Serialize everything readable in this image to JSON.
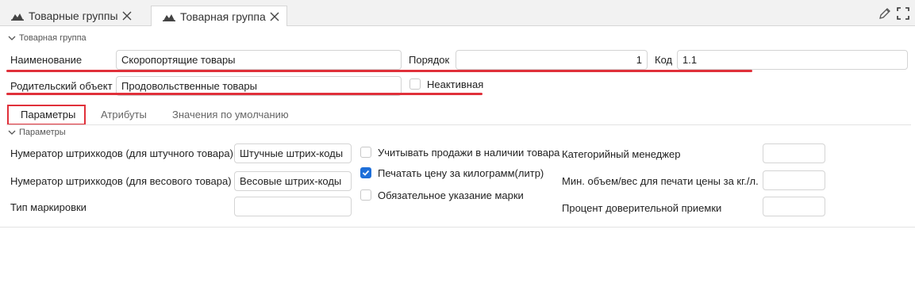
{
  "tabs": [
    {
      "label": "Товарные группы",
      "active": false
    },
    {
      "label": "Товарная группа",
      "active": true
    }
  ],
  "toolbar_icons": [
    "pencil-icon",
    "expand-icon"
  ],
  "group_section": {
    "title": "Товарная группа",
    "name_label": "Наименование",
    "name_value": "Скоропортящие товары",
    "order_label": "Порядок",
    "order_value": "1",
    "code_label": "Код",
    "code_value": "1.1",
    "parent_label": "Родительский объект",
    "parent_value": "Продовольственные товары",
    "inactive_label": "Неактивная",
    "inactive_checked": false
  },
  "subtabs": [
    {
      "label": "Параметры",
      "active": true
    },
    {
      "label": "Атрибуты",
      "active": false
    },
    {
      "label": "Значения по умолчанию",
      "active": false
    }
  ],
  "params_section": {
    "title": "Параметры",
    "piece_barcode_label": "Нумератор штрихкодов (для штучного товара)",
    "piece_barcode_value": "Штучные штрих-коды",
    "weight_barcode_label": "Нумератор штрихкодов (для весового товара)",
    "weight_barcode_value": "Весовые штрих-коды",
    "marking_type_label": "Тип маркировки",
    "marking_type_value": "",
    "check_sales_label": "Учитывать продажи в наличии товара",
    "check_sales_checked": false,
    "print_price_label": "Печатать цену за килограмм(литр)",
    "print_price_checked": true,
    "mandatory_mark_label": "Обязательное указание марки",
    "mandatory_mark_checked": false,
    "category_manager_label": "Категорийный менеджер",
    "category_manager_value": "",
    "min_volume_label": "Мин. объем/вес для печати цены за кг./л.",
    "min_volume_value": "",
    "trust_percent_label": "Процент доверительной приемки",
    "trust_percent_value": ""
  },
  "colors": {
    "highlight": "#e0303a",
    "checkbox_checked": "#1e6fd9"
  }
}
